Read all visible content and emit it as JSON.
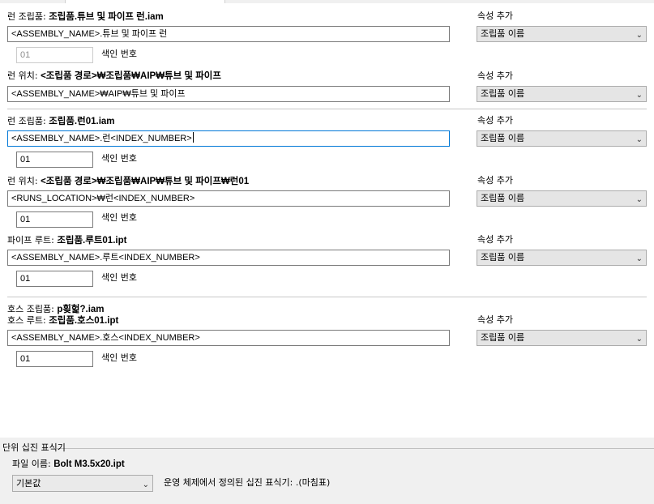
{
  "rows": [
    {
      "title": "런 조립품: ",
      "title_value": "조립품.튜브 및 파이프 런.iam",
      "expression": "<ASSEMBLY_NAME>.튜브 및 파이프 런",
      "index": "01",
      "index_disabled": true,
      "index_label": "색인 번호",
      "add_prop_label": "속성 추가",
      "select_value": "조립품 이름"
    },
    {
      "title": "런 위치: ",
      "title_value": "<조립품 경로>₩조립품₩AIP₩튜브 및 파이프",
      "expression": "<ASSEMBLY_NAME>₩AIP₩튜브 및 파이프",
      "add_prop_label": "속성 추가",
      "select_value": "조립품 이름"
    },
    {
      "title": "런 조립품: ",
      "title_value": "조립품.런01.iam",
      "expression": "<ASSEMBLY_NAME>.런<INDEX_NUMBER>",
      "index": "01",
      "index_label": "색인 번호",
      "add_prop_label": "속성 추가",
      "select_value": "조립품 이름"
    },
    {
      "title": "런 위치: ",
      "title_value": "<조립품 경로>₩조립품₩AIP₩튜브 및 파이프₩런01",
      "expression": "<RUNS_LOCATION>₩런<INDEX_NUMBER>",
      "index": "01",
      "index_label": "색인 번호",
      "add_prop_label": "속성 추가",
      "select_value": "조립품 이름"
    },
    {
      "title": "파이프 루트: ",
      "title_value": "조립품.루트01.ipt",
      "expression": "<ASSEMBLY_NAME>.루트<INDEX_NUMBER>",
      "index": "01",
      "index_label": "색인 번호",
      "add_prop_label": "속성 추가",
      "select_value": "조립품 이름"
    },
    {
      "title": "호스 조립품: ",
      "title_value": "p횢헕?.iam",
      "title2": "호스 루트: ",
      "title2_value": "조립품.호스01.ipt",
      "expression": "<ASSEMBLY_NAME>.호스<INDEX_NUMBER>",
      "index": "01",
      "index_label": "색인 번호",
      "add_prop_label": "속성 추가",
      "select_value": "조립품 이름"
    }
  ],
  "separator": {
    "title": "단위 십진 표식기",
    "file_label": "파일 이름: ",
    "file_value": "Bolt M3.5x20.ipt",
    "combo_value": "기본값",
    "os_text": "운영 체제에서 정의된 십진 표식기: .(마침표)"
  }
}
